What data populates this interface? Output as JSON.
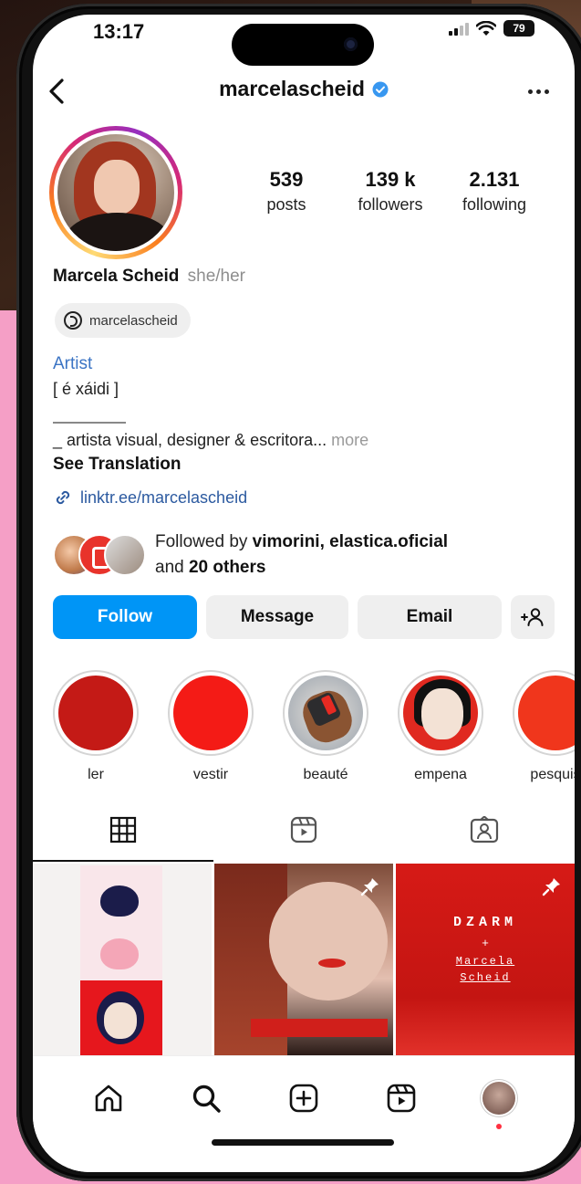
{
  "status_bar": {
    "time": "13:17",
    "battery": "79"
  },
  "header": {
    "username": "marcelascheid"
  },
  "profile": {
    "stats": [
      {
        "value": "539",
        "label": "posts"
      },
      {
        "value": "139 k",
        "label": "followers"
      },
      {
        "value": "2.131",
        "label": "following"
      }
    ],
    "full_name": "Marcela Scheid",
    "pronouns": "she/her",
    "threads_handle": "marcelascheid",
    "category": "Artist",
    "bio_line1": "[ é xáidi ]",
    "bio_line2": "_ artista visual, designer & escritora...",
    "bio_more": "more",
    "see_translation": "See Translation",
    "link": "linktr.ee/marcelascheid",
    "followed_by": {
      "prefix": "Followed by",
      "names": "vimorini, elastica.oficial",
      "and": "and",
      "others": "20 others"
    }
  },
  "actions": {
    "follow": "Follow",
    "message": "Message",
    "email": "Email"
  },
  "highlights": [
    {
      "label": "ler",
      "color": "#c41a16"
    },
    {
      "label": "vestir",
      "color": "#f41b16"
    },
    {
      "label": "beauté"
    },
    {
      "label": "empena"
    },
    {
      "label": "pesquis",
      "color": "#f0361c"
    }
  ],
  "posts": {
    "post3": {
      "title": "DZARM",
      "plus": "+",
      "line1": "Marcela",
      "line2": "Scheid"
    }
  },
  "colors": {
    "follow_blue": "#0095f6",
    "link_blue": "#2c5aa0",
    "verified_blue": "#3897f0"
  }
}
